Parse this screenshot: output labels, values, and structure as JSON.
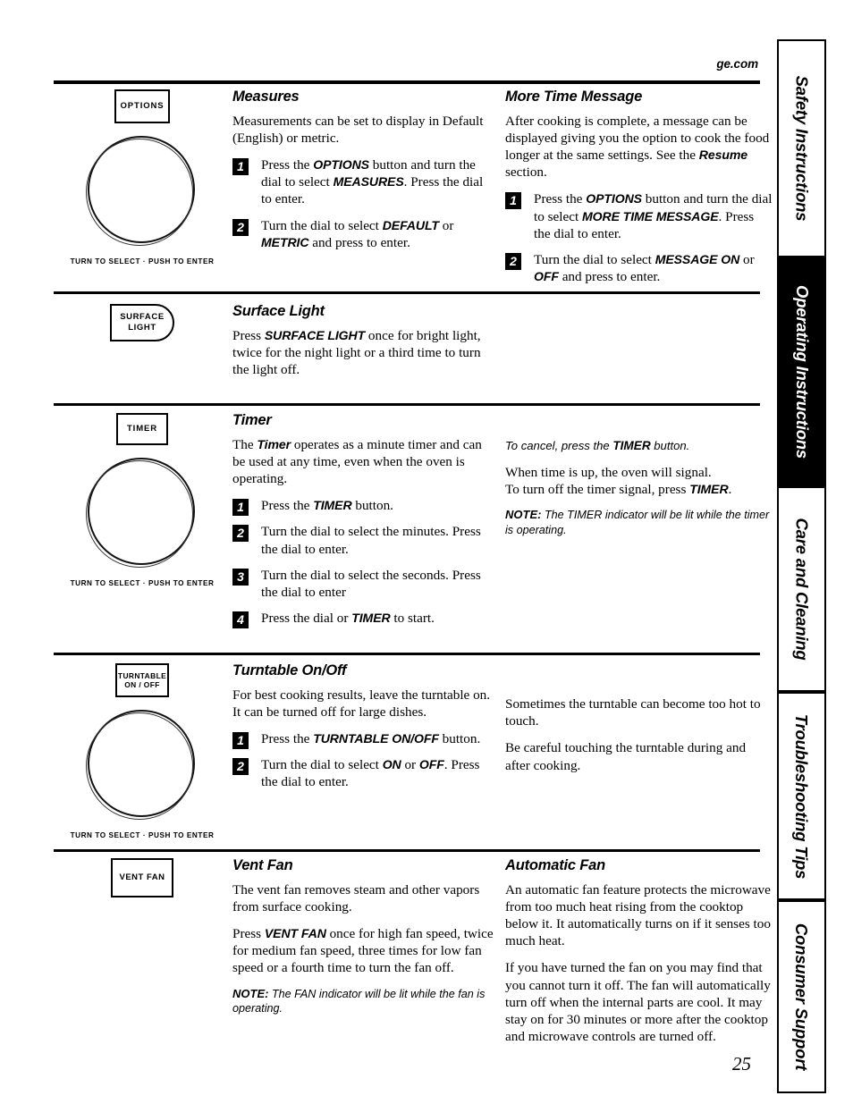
{
  "page": {
    "site_url": "ge.com",
    "number": "25"
  },
  "tabs": [
    {
      "label": "Safety Instructions",
      "active": false
    },
    {
      "label": "Operating Instructions",
      "active": true
    },
    {
      "label": "Care and Cleaning",
      "active": false
    },
    {
      "label": "Troubleshooting Tips",
      "active": false
    },
    {
      "label": "Consumer Support",
      "active": false
    }
  ],
  "dial_caption": "TURN TO SELECT  ·  PUSH TO ENTER",
  "sections": {
    "measures": {
      "button_label": "OPTIONS",
      "heading": "Measures",
      "intro": "Measurements can be set to display in Default (English) or metric.",
      "steps": [
        {
          "num": "1",
          "pre": "Press the ",
          "kw1": "OPTIONS",
          "mid": " button and turn the dial to select ",
          "kw2": "MEASURES",
          "post": ". Press the dial to enter."
        },
        {
          "num": "2",
          "pre": "Turn the dial to select ",
          "kw1": "DEFAULT",
          "mid": " or ",
          "kw2": "METRIC",
          "post": " and press to enter."
        }
      ]
    },
    "more_time_message": {
      "heading": "More Time Message",
      "intro_a": "After cooking is complete, a message can be displayed giving you the option to cook the food longer at the same settings.  See the ",
      "intro_kw": "Resume",
      "intro_b": " section.",
      "steps": [
        {
          "num": "1",
          "pre": "Press the ",
          "kw1": "OPTIONS",
          "mid": " button and turn the dial to select ",
          "kw2": "MORE TIME MESSAGE",
          "post": ". Press the dial to enter."
        },
        {
          "num": "2",
          "pre": "Turn the dial to select ",
          "kw1": "MESSAGE ON",
          "mid": " or ",
          "kw2": "OFF",
          "post": " and press to enter."
        }
      ]
    },
    "surface_light": {
      "button_label_line1": "SURFACE",
      "button_label_line2": "LIGHT",
      "heading": "Surface Light",
      "body_pre": "Press ",
      "body_kw": "SURFACE LIGHT",
      "body_post": " once for bright light, twice for the night light or a third time to turn the light off."
    },
    "timer": {
      "button_label": "TIMER",
      "heading": "Timer",
      "intro_pre": "The ",
      "intro_kw": "Timer",
      "intro_post": " operates as a minute timer and can be used at any time, even when the oven is operating.",
      "steps": [
        {
          "num": "1",
          "pre": "Press the ",
          "kw1": "TIMER",
          "post": " button."
        },
        {
          "num": "2",
          "pre": "Turn the dial to select the minutes. Press the dial to enter."
        },
        {
          "num": "3",
          "pre": "Turn the dial to select the seconds. Press the dial to enter"
        },
        {
          "num": "4",
          "pre": "Press the dial or ",
          "kw1": "TIMER",
          "post": " to start."
        }
      ],
      "cancel_pre": "To cancel, press the ",
      "cancel_kw": "TIMER",
      "cancel_post": " button.",
      "signal_a": "When time is up, the oven will signal.",
      "signal_b": "To turn off the timer signal, press ",
      "signal_kw": "TIMER",
      "signal_c": ".",
      "note_label": "NOTE:",
      "note_text": " The TIMER indicator will be lit while the timer is operating."
    },
    "turntable": {
      "button_label_line1": "TURNTABLE",
      "button_label_line2": "ON / OFF",
      "heading": "Turntable On/Off",
      "intro": "For best cooking results, leave the turntable on. It can be turned off for large dishes.",
      "steps": [
        {
          "num": "1",
          "pre": "Press the ",
          "kw1": "TURNTABLE ON/OFF",
          "post": " button."
        },
        {
          "num": "2",
          "pre": "Turn the dial to select ",
          "kw1": "ON",
          "mid": " or ",
          "kw2": "OFF",
          "post": ". Press the dial to enter."
        }
      ],
      "side_a": "Sometimes the turntable can become too hot to touch.",
      "side_b": "Be careful touching the turntable during and after cooking."
    },
    "vent_fan": {
      "button_label": "VENT FAN",
      "heading": "Vent Fan",
      "body_a": "The vent fan removes steam and other vapors from surface cooking.",
      "body_b_pre": "Press ",
      "body_b_kw": "VENT FAN",
      "body_b_post": " once for high fan speed, twice for medium fan speed, three times for low fan speed or a fourth time to turn the fan off.",
      "note_label": "NOTE:",
      "note_text": " The FAN indicator will be lit while the fan is operating."
    },
    "automatic_fan": {
      "heading": "Automatic Fan",
      "body_a": "An automatic fan feature protects the microwave from too much heat rising from the cooktop below it. It automatically turns on if it senses too much heat.",
      "body_b": "If you have turned the fan on you may find that you cannot turn it off. The fan will automatically turn off when the internal parts are cool. It may stay on for 30 minutes or more after the cooktop and microwave controls are turned off."
    }
  }
}
